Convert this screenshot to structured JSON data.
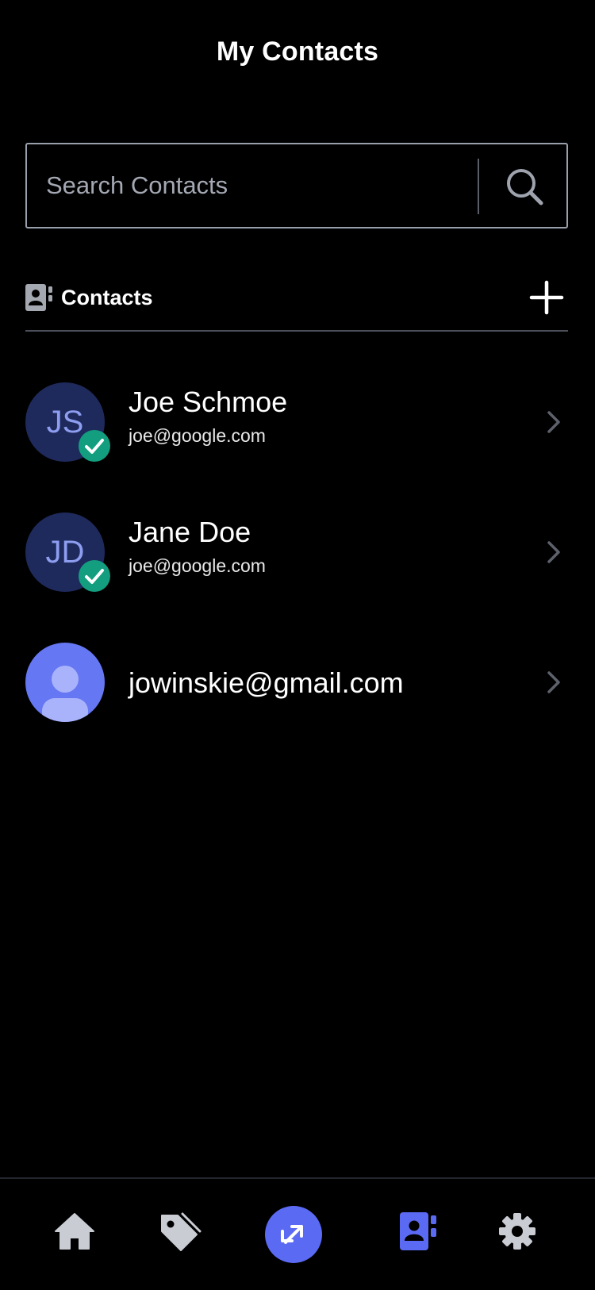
{
  "header": {
    "title": "My Contacts"
  },
  "search": {
    "placeholder": "Search Contacts",
    "value": "",
    "icon": "search-icon"
  },
  "contacts_section": {
    "label": "Contacts",
    "icon": "contact-book-icon",
    "add_icon": "plus-icon"
  },
  "contacts": [
    {
      "initials": "JS",
      "name": "Joe Schmoe",
      "email": "joe@google.com",
      "verified": true
    },
    {
      "initials": "JD",
      "name": "Jane Doe",
      "email": "joe@google.com",
      "verified": true
    },
    {
      "initials": "",
      "name": "jowinskie@gmail.com",
      "email": "",
      "verified": false
    }
  ],
  "bottom_nav": {
    "items": [
      {
        "icon": "home-icon",
        "active": false
      },
      {
        "icon": "tag-icon",
        "active": false
      },
      {
        "icon": "transfer-icon",
        "active": false
      },
      {
        "icon": "contact-book-icon",
        "active": true
      },
      {
        "icon": "gear-icon",
        "active": false
      }
    ]
  },
  "colors": {
    "background": "#000000",
    "accent": "#5b6af3",
    "avatar_bg": "#1f2a5c",
    "avatar_text": "#8d9df0",
    "verified_badge": "#129e7f",
    "nav_icon": "#c9ccd3"
  }
}
